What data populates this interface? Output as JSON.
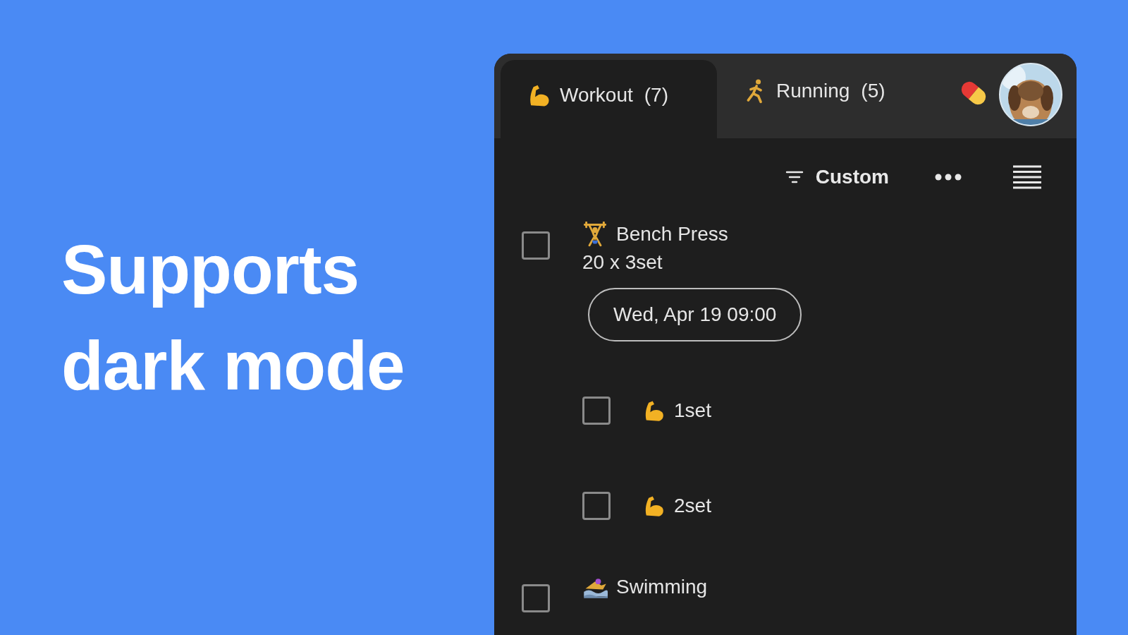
{
  "headline": "Supports dark mode",
  "tabs": [
    {
      "kind": "muscle",
      "label": "Workout",
      "count": "(7)",
      "selected": true
    },
    {
      "kind": "runner",
      "label": "Running",
      "count": "(5)",
      "selected": false
    }
  ],
  "toolbar": {
    "sort_label": "Custom"
  },
  "tasks": [
    {
      "kind": "weightlifter",
      "title": "Bench Press",
      "detail": "20 x 3set",
      "date": "Wed, Apr 19 09:00",
      "checked": false,
      "subtasks": [
        {
          "kind": "muscle",
          "label": "1set",
          "checked": false
        },
        {
          "kind": "muscle",
          "label": "2set",
          "checked": false
        }
      ]
    },
    {
      "kind": "swimmer",
      "title": "Swimming",
      "checked": false
    }
  ]
}
